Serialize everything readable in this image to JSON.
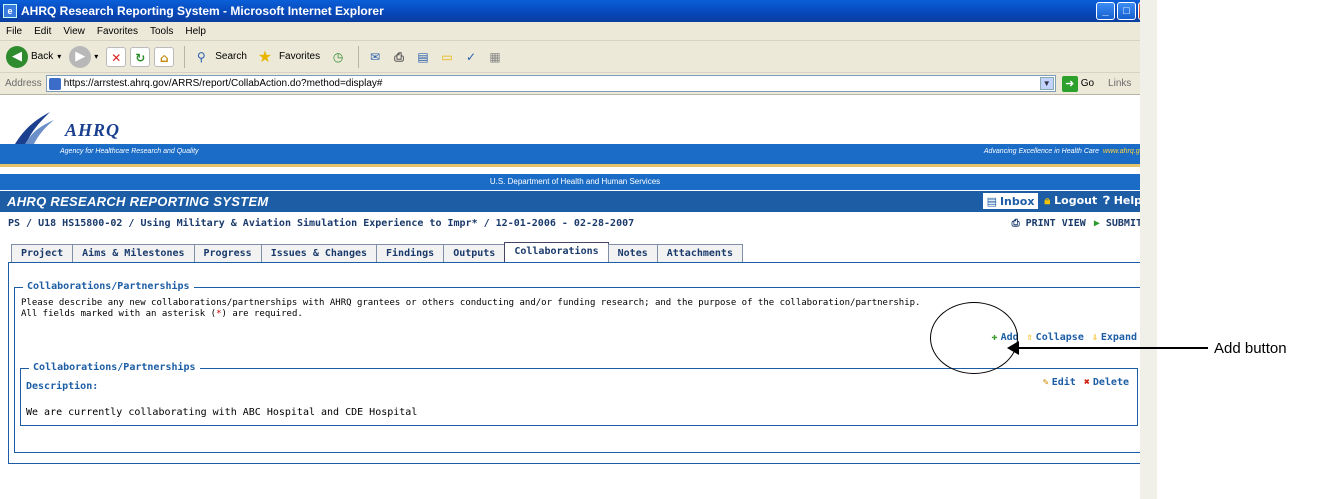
{
  "window": {
    "title": "AHRQ Research Reporting System - Microsoft Internet Explorer",
    "menu": [
      "File",
      "Edit",
      "View",
      "Favorites",
      "Tools",
      "Help"
    ]
  },
  "toolbar": {
    "back": "Back",
    "search": "Search",
    "favorites": "Favorites"
  },
  "address": {
    "label": "Address",
    "url": "https://arrstest.ahrq.gov/ARRS/report/CollabAction.do?method=display#",
    "go": "Go",
    "links": "Links"
  },
  "header": {
    "logo": "AHRQ",
    "agency": "Agency for Healthcare Research and Quality",
    "tagline": "Advancing Excellence in Health Care",
    "tagline_url": "www.ahrq.gov",
    "hhs": "U.S. Department of Health and Human Services",
    "app_title": "AHRQ RESEARCH REPORTING SYSTEM",
    "inbox": "Inbox",
    "logout": "Logout",
    "help": "Help"
  },
  "path": {
    "text": "PS / U18 HS15800-02 / Using Military & Aviation Simulation Experience to Impr* / 12-01-2006 - 02-28-2007",
    "print_view": "PRINT VIEW",
    "submit": "SUBMIT"
  },
  "tabs": [
    "Project",
    "Aims & Milestones",
    "Progress",
    "Issues & Changes",
    "Findings",
    "Outputs",
    "Collaborations",
    "Notes",
    "Attachments"
  ],
  "active_tab": "Collaborations",
  "section": {
    "legend": "Collaborations/Partnerships",
    "description_line1": "Please describe any new collaborations/partnerships with AHRQ grantees or others conducting and/or funding research; and the purpose of the collaboration/partnership.",
    "description_line2_prefix": "All fields marked with an asterisk (",
    "asterisk": "*",
    "description_line2_suffix": ") are required.",
    "add": "Add",
    "collapse": "Collapse",
    "expand": "Expand"
  },
  "record": {
    "legend": "Collaborations/Partnerships",
    "label": "Description:",
    "value": "We are currently collaborating with ABC Hospital and CDE Hospital",
    "edit": "Edit",
    "delete": "Delete"
  },
  "annotation": {
    "text": "Add button"
  }
}
